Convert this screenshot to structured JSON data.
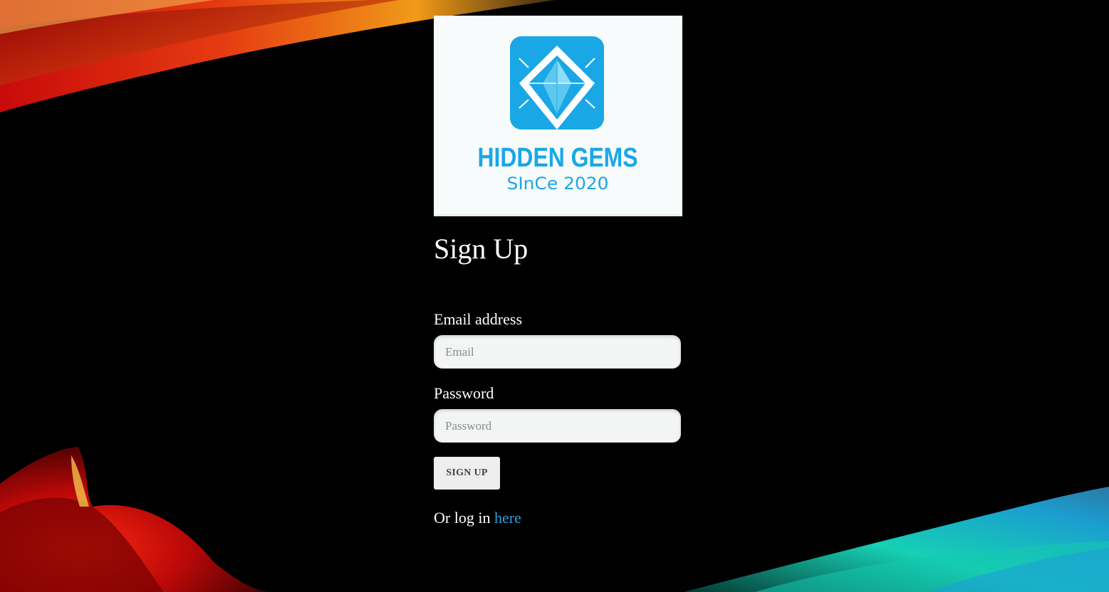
{
  "logo": {
    "brand": "HIDDEN GEMS",
    "tagline": "SInCe 2020"
  },
  "page": {
    "title": "Sign Up"
  },
  "form": {
    "email_label": "Email address",
    "email_placeholder": "Email",
    "email_value": "",
    "password_label": "Password",
    "password_placeholder": "Password",
    "password_value": "",
    "submit_label": "SIGN UP"
  },
  "footer": {
    "prefix": "Or log in ",
    "link_label": "here"
  },
  "colors": {
    "background": "#000000",
    "brand_blue": "#1aa7e6",
    "link": "#2d9fd9",
    "input_bg": "#f3f5f4"
  }
}
